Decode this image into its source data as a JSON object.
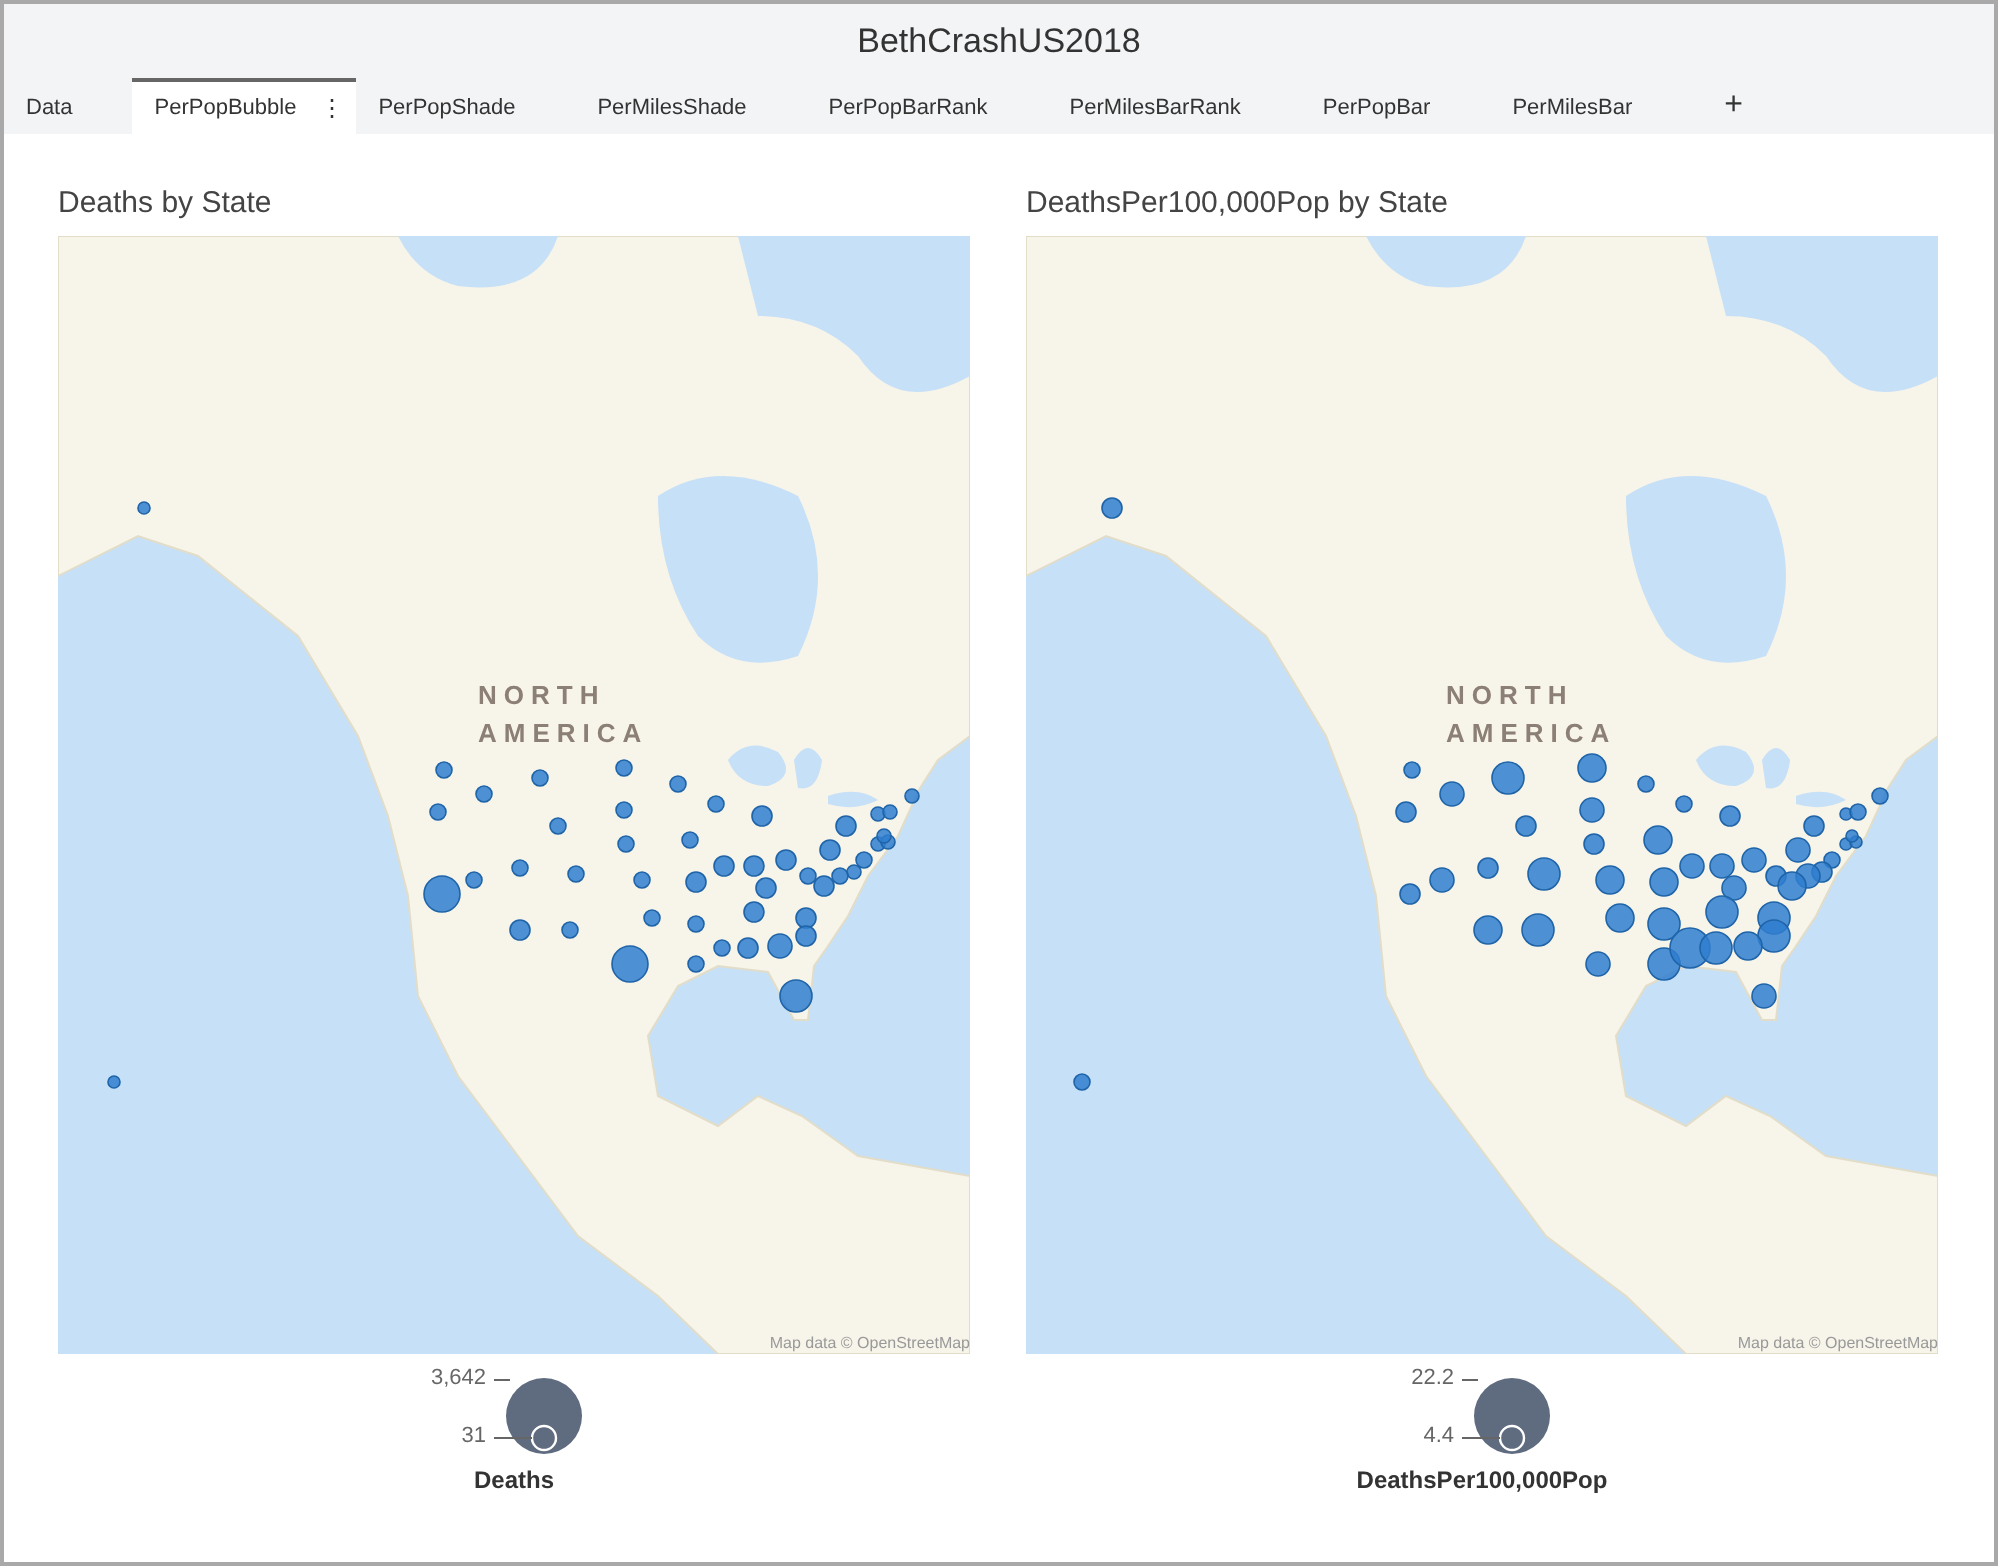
{
  "window": {
    "title": "BethCrashUS2018"
  },
  "tabs": [
    {
      "label": "Data",
      "selected": false
    },
    {
      "label": "PerPopBubble",
      "selected": true,
      "menu": "⋮"
    },
    {
      "label": "PerPopShade",
      "selected": false
    },
    {
      "label": "PerMilesShade",
      "selected": false
    },
    {
      "label": "PerPopBarRank",
      "selected": false
    },
    {
      "label": "PerMilesBarRank",
      "selected": false
    },
    {
      "label": "PerPopBar",
      "selected": false
    },
    {
      "label": "PerMilesBar",
      "selected": false
    }
  ],
  "add_tab": "+",
  "panels": [
    {
      "title": "Deaths by State",
      "map_labels": [
        "NORTH",
        "AMERICA"
      ],
      "attribution": "Map data © OpenStreetMap",
      "legend": {
        "max_label": "3,642",
        "min_label": "31",
        "title": "Deaths"
      }
    },
    {
      "title": "DeathsPer100,000Pop by State",
      "map_labels": [
        "NORTH",
        "AMERICA"
      ],
      "attribution": "Map data © OpenStreetMap",
      "legend": {
        "max_label": "22.2",
        "min_label": "4.4",
        "title": "DeathsPer100,000Pop"
      }
    }
  ]
}
